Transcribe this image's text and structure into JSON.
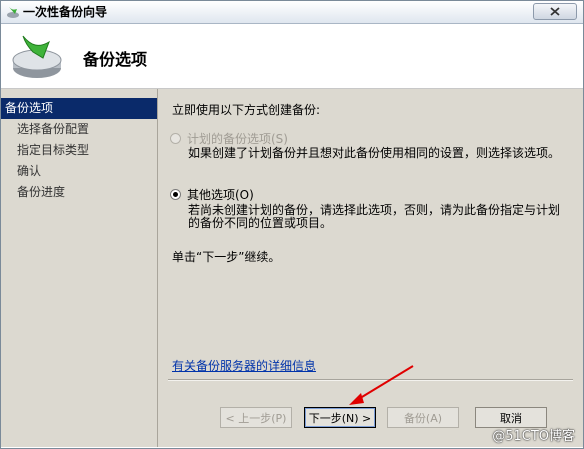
{
  "window": {
    "title": "一次性备份向导"
  },
  "header": {
    "title": "备份选项",
    "icon": "backup-disk-icon"
  },
  "sidebar": {
    "items": [
      {
        "label": "备份选项",
        "active": true
      },
      {
        "label": "选择备份配置",
        "active": false
      },
      {
        "label": "指定目标类型",
        "active": false
      },
      {
        "label": "确认",
        "active": false
      },
      {
        "label": "备份进度",
        "active": false
      }
    ]
  },
  "content": {
    "intro": "立即使用以下方式创建备份:",
    "options": [
      {
        "label": "计划的备份选项(S)",
        "description": "如果创建了计划备份并且想对此备份使用相同的设置，则选择该选项。",
        "checked": false,
        "enabled": false
      },
      {
        "label": "其他选项(O)",
        "description": "若尚未创建计划的备份，请选择此选项，否则，请为此备份指定与计划的备份不同的位置或项目。",
        "checked": true,
        "enabled": true
      }
    ],
    "hint": "单击“下一步”继续。",
    "link": "有关备份服务器的详细信息"
  },
  "buttons": {
    "back": "< 上一步(P)",
    "next": "下一步(N) >",
    "backup": "备份(A)",
    "cancel": "取消"
  },
  "watermark": "@51CTO博客",
  "colors": {
    "sidebar_active": "#0a2a6a",
    "panel_bg": "#dcd9d0",
    "annotation_arrow": "#e00000"
  }
}
